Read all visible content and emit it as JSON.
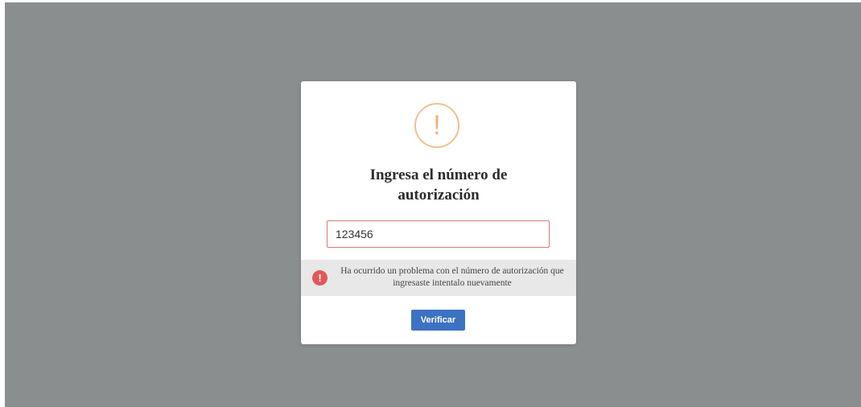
{
  "modal": {
    "title": "Ingresa el número de autorización",
    "warning_icon_symbol": "!",
    "warning_icon": "warning-icon",
    "input_value": "123456",
    "error": {
      "icon_symbol": "!",
      "icon": "error-icon",
      "message": "Ha ocurrido un problema con el número de autorización que ingresaste intentalo nuevamente"
    },
    "verify_label": "Verificar"
  },
  "colors": {
    "overlay": "#8b8e8f",
    "warning_accent": "#f0c08e",
    "error_red": "#e0595a",
    "input_border": "#d9787a",
    "button_blue": "#3d72c2"
  }
}
